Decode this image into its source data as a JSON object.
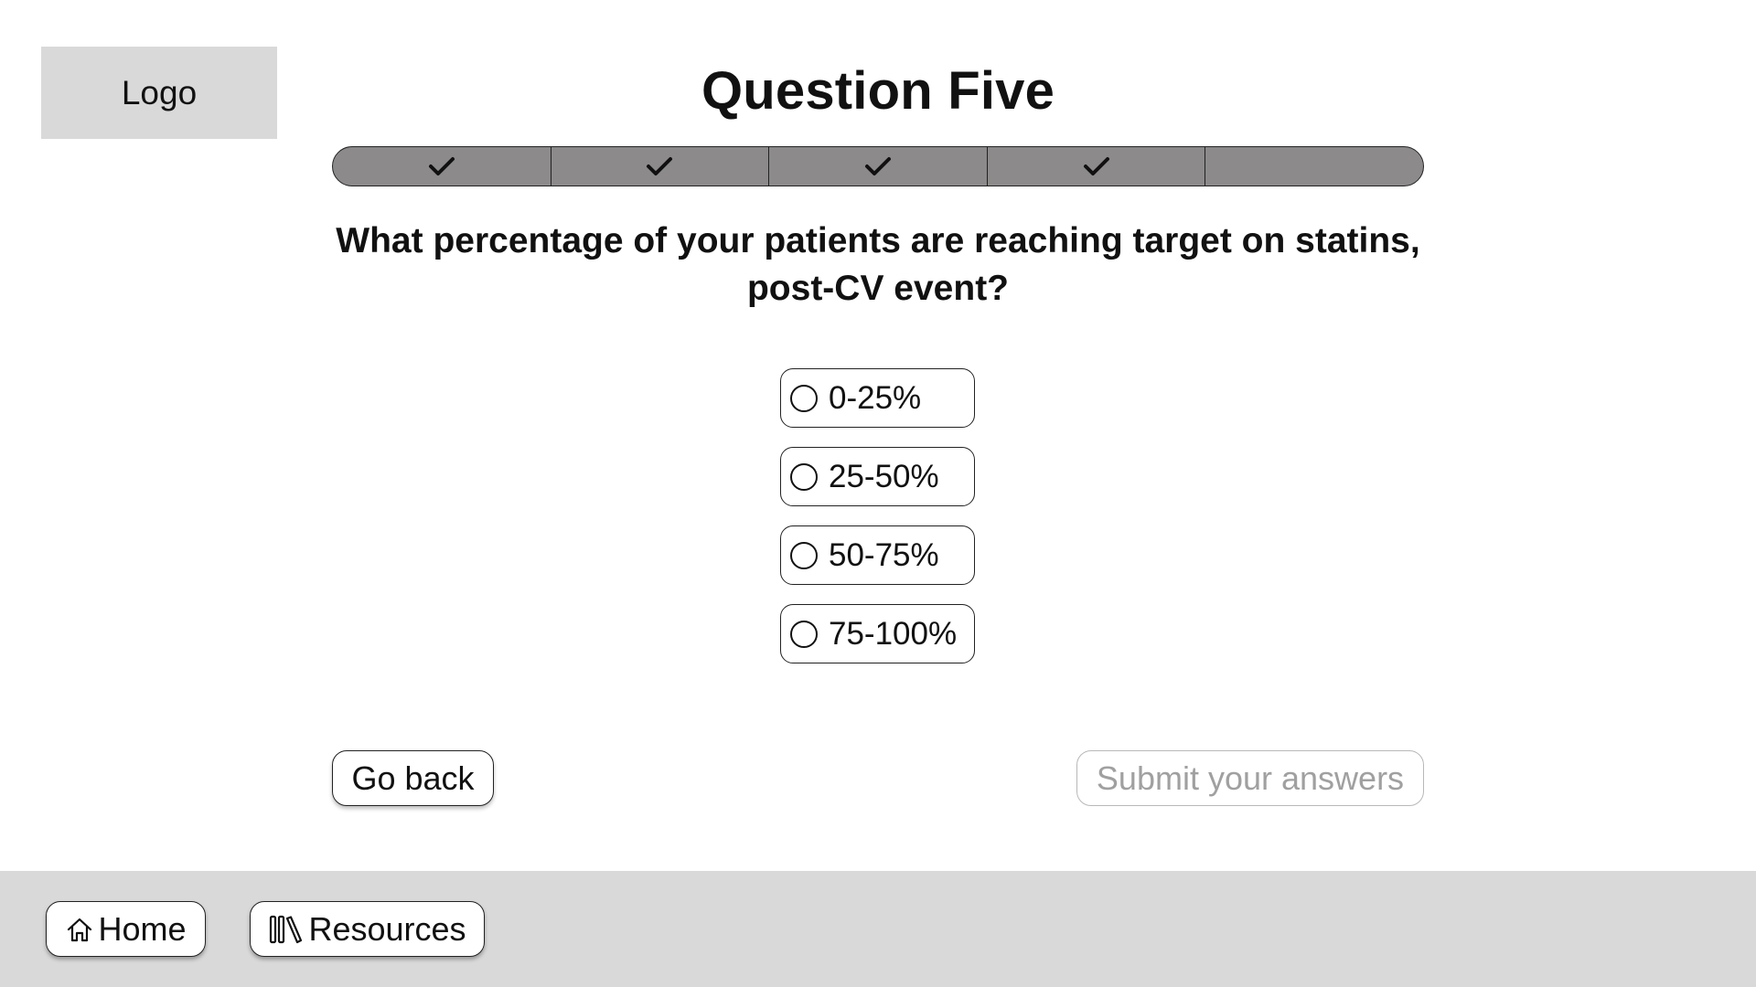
{
  "logo": {
    "label": "Logo"
  },
  "page_title": "Question Five",
  "progress": {
    "total_steps": 5,
    "steps": [
      {
        "completed": true,
        "icon": "check-icon"
      },
      {
        "completed": true,
        "icon": "check-icon"
      },
      {
        "completed": true,
        "icon": "check-icon"
      },
      {
        "completed": true,
        "icon": "check-icon"
      },
      {
        "completed": false,
        "icon": ""
      }
    ]
  },
  "question": "What percentage of your patients are reaching target on statins, post-CV event?",
  "options": [
    {
      "label": "0-25%",
      "selected": false
    },
    {
      "label": "25-50%",
      "selected": false
    },
    {
      "label": "50-75%",
      "selected": false
    },
    {
      "label": "75-100%",
      "selected": false
    }
  ],
  "actions": {
    "back_label": "Go back",
    "submit_label": "Submit your answers",
    "submit_enabled": false
  },
  "footer": {
    "home": {
      "label": "Home",
      "icon": "home-icon"
    },
    "resources": {
      "label": "Resources",
      "icon": "books-icon"
    }
  },
  "colors": {
    "progress_fill": "#8c8a8a",
    "logo_bg": "#d9d9d9",
    "footer_bg": "#d9d9d9",
    "disabled_text": "#a0a0a0"
  }
}
